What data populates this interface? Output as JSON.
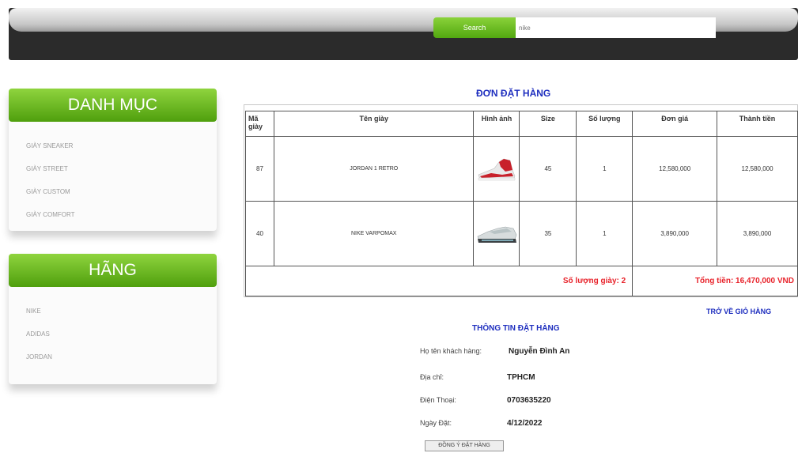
{
  "search": {
    "button_label": "Search",
    "placeholder": "nike"
  },
  "sidebar": {
    "categories": {
      "title": "DANH MỤC",
      "items": [
        "GIÀY SNEAKER",
        "GIÀY STREET",
        "GIÀY CUSTOM",
        "GIÀY COMFORT"
      ]
    },
    "brands": {
      "title": "HÃNG",
      "items": [
        "NIKE",
        "ADIDAS",
        "JORDAN"
      ]
    }
  },
  "order": {
    "title": "ĐƠN ĐẶT HÀNG",
    "columns": [
      "Mã giày",
      "Tên giày",
      "Hình ảnh",
      "Size",
      "Số lượng",
      "Đơn giá",
      "Thành tiền"
    ],
    "rows": [
      {
        "id": "87",
        "name": "JORDAN 1 RETRO",
        "image": "red-white-sneaker-image",
        "size": "45",
        "qty": "1",
        "price": "12,580,000",
        "total": "12,580,000"
      },
      {
        "id": "40",
        "name": "NIKE VARPOMAX",
        "image": "grey-white-sneaker-image",
        "size": "35",
        "qty": "1",
        "price": "3,890,000",
        "total": "3,890,000"
      }
    ],
    "summary_qty": "Số lượng giày: 2",
    "summary_total": "Tổng tiền: 16,470,000 VND",
    "back_link": "TRỞ VỀ GIỎ HÀNG"
  },
  "info": {
    "title": "THÔNG TIN ĐẶT HÀNG",
    "customer_label": "Họ tên khách hàng:",
    "customer_value": "Nguyễn Đình An",
    "address_label": "Địa chỉ:",
    "address_value": "TPHCM",
    "phone_label": "Điện Thoại:",
    "phone_value": "0703635220",
    "date_label": "Ngày Đặt:",
    "date_value": "4/12/2022",
    "confirm_button": "ĐỒNG Ý ĐẶT HÀNG"
  },
  "colors": {
    "accent_green": "#6cbb22",
    "link_blue": "#1f2fbf",
    "total_red": "#e8222a",
    "header_dark": "#2b2b2b"
  }
}
